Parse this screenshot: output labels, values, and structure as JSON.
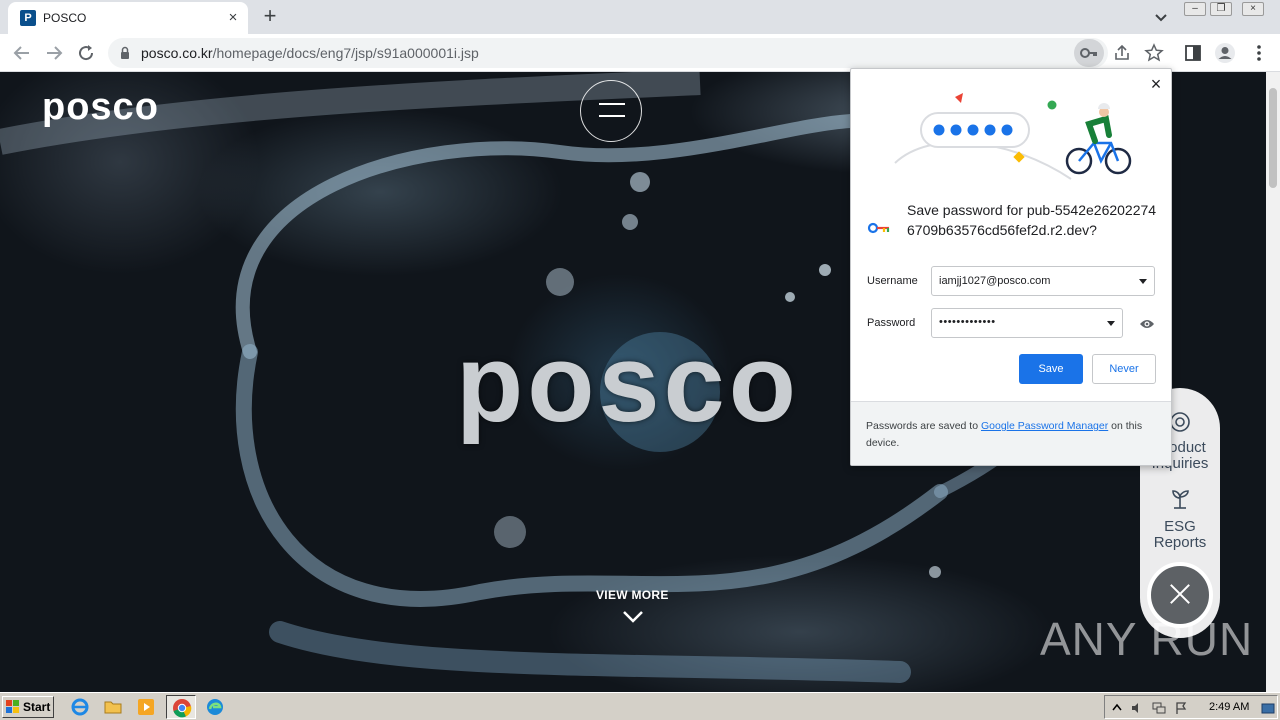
{
  "browser": {
    "tab": {
      "favicon": "P",
      "title": "POSCO",
      "close": "×"
    },
    "new_tab": "+",
    "url": {
      "host": "posco.co.kr",
      "path": "/homepage/docs/eng7/jsp/s91a000001i.jsp"
    }
  },
  "page": {
    "logo": "posco",
    "hero_logo": "posco",
    "view_more": "VIEW MORE",
    "side_items": [
      {
        "label_1": "Product",
        "label_2": "Inquiries",
        "icon": "inquiry-icon"
      },
      {
        "label_1": "ESG",
        "label_2": "Reports",
        "icon": "sprout-icon"
      }
    ],
    "watermark": "ANY RUN"
  },
  "password_bubble": {
    "title": "Save password for pub-5542e262022746709b63576cd56fef2d.r2.dev?",
    "username_label": "Username",
    "username_value": "iamjj1027@posco.com",
    "password_label": "Password",
    "password_value": "•••••••••••••",
    "save_label": "Save",
    "never_label": "Never",
    "footer_prefix": "Passwords are saved to ",
    "footer_link": "Google Password Manager",
    "footer_suffix": " on this device.",
    "colors": {
      "primary": "#1a73e8"
    }
  },
  "taskbar": {
    "start_label": "Start",
    "clock": "2:49 AM"
  }
}
